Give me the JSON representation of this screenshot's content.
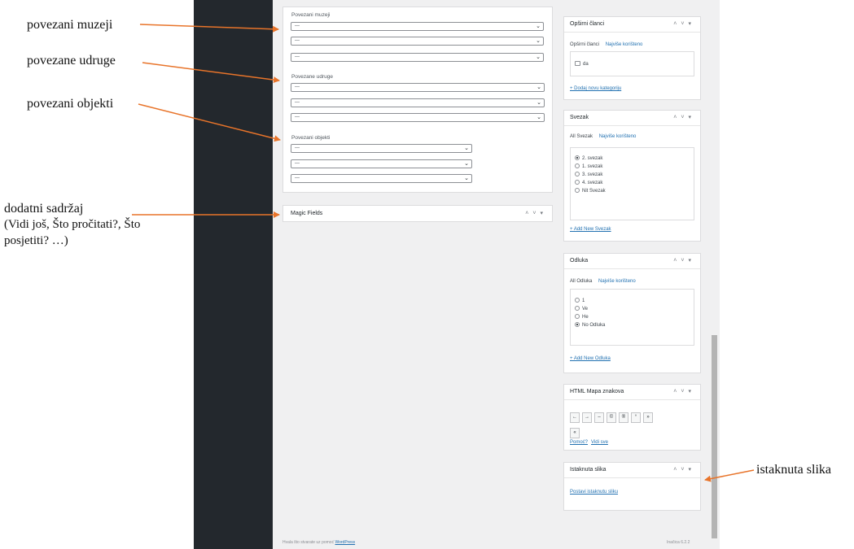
{
  "annotations": {
    "museums": "povezani muzeji",
    "associations": "povezane udruge",
    "objects": "povezani objekti",
    "extra_line1": "dodatni sadržaj",
    "extra_line2": "(Vidi još, Što pročitati?, Što",
    "extra_line3": "posjetiti? …)",
    "featured": "istaknuta slika"
  },
  "arrow_color": "#e8742a",
  "main": {
    "museums_label": "Povezani muzeji",
    "associations_label": "Povezane udruge",
    "objects_label": "Povezani objekti",
    "select_value": "—",
    "magic_fields_title": "Magic Fields"
  },
  "sidebar_boxes": {
    "categories": {
      "title": "Opširni članci",
      "tab_all": "Opširni članci",
      "tab_most_used": "Najviše korišteno",
      "options": [
        {
          "label": "da",
          "checked": false
        }
      ],
      "add_link": "+ Dodaj novu kategoriju"
    },
    "volume": {
      "title": "Svezak",
      "tab_all": "All Svezak",
      "tab_most_used": "Najviše korišteno",
      "options": [
        {
          "label": "2. svezak",
          "selected": true
        },
        {
          "label": "1. svezak",
          "selected": false
        },
        {
          "label": "3. svezak",
          "selected": false
        },
        {
          "label": "4. svezak",
          "selected": false
        },
        {
          "label": "Nit Svezak",
          "selected": false
        }
      ],
      "add_link": "+ Add New Svezak"
    },
    "section": {
      "title": "Odlukа",
      "tab_all": "All Odluka",
      "tab_most_used": "Najviše korišteno",
      "options": [
        {
          "label": "1",
          "selected": false
        },
        {
          "label": "Ve",
          "selected": false
        },
        {
          "label": "He",
          "selected": false
        },
        {
          "label": "No Odluka",
          "selected": true
        }
      ],
      "add_link": "+ Add New Odluka"
    },
    "html_symbols": {
      "title": "HTML Mapa znakova",
      "buttons": [
        "←",
        "→",
        "–",
        "©",
        "®",
        "°",
        "»",
        "«"
      ],
      "link_help": "Pomoć?",
      "link_all": "Vidi sve"
    },
    "featured_image": {
      "title": "Istaknuta slika",
      "link": "Postavi istaknutu sliku"
    }
  },
  "footer": {
    "thanks_prefix": "Hvala što stvarate uz pomoć",
    "wordpress_link": "WordPress",
    "version": "Inačica 6.2.2"
  }
}
